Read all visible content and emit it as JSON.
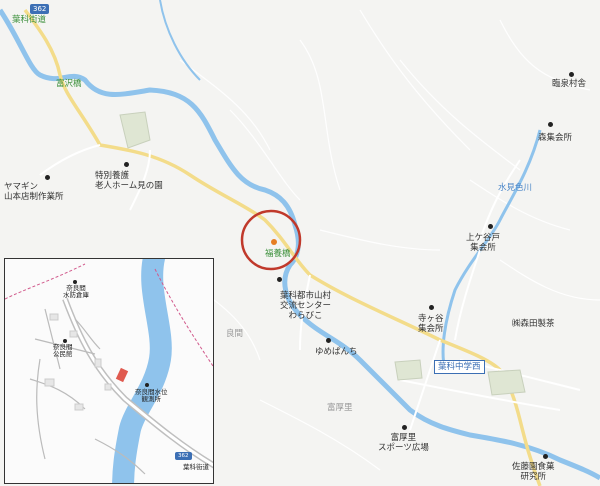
{
  "route_number": "362",
  "road_name": "葉科街道",
  "bridges": {
    "tomisawa": "富沢橋",
    "fukuyo": "福養橋"
  },
  "places": {
    "nursing_home": "特別養護\n老人ホーム見の園",
    "yamagin": "ヤマギン\n山本店制作業所",
    "rinsen": "臨泉村舎",
    "mori_hall": "森集会所",
    "mizumiiro_river": "水見色川",
    "kamigaya": "上ケ谷戸\n集会所",
    "village_center": "葉科都市山村\n交流センター\nわらびこ",
    "teragaya": "寺ヶ谷\n集会所",
    "yumebanchi": "ゆめぱんち",
    "morita_tea": "㈱森田製茶",
    "ryoma": "良間",
    "tomiatsuri": "富厚里",
    "tomiatsuri_sports": "富厚里\nスポーツ広場",
    "sato_food": "佐藤園食菓\n研究所"
  },
  "school_label": "葉科中学西",
  "inset": {
    "route_number": "362",
    "road_name": "葉科街道",
    "places": {
      "narama_water": "奈良間\n水防倉庫",
      "narama_hall": "奈良間\n公民館",
      "narama_obs": "奈良間水位\n観測所"
    }
  },
  "colors": {
    "river": "#8fc3ec",
    "road": "#f3dc8a",
    "minor_road": "#ffffff",
    "marker": "#c0392b",
    "boundary": "#d15a8c"
  }
}
